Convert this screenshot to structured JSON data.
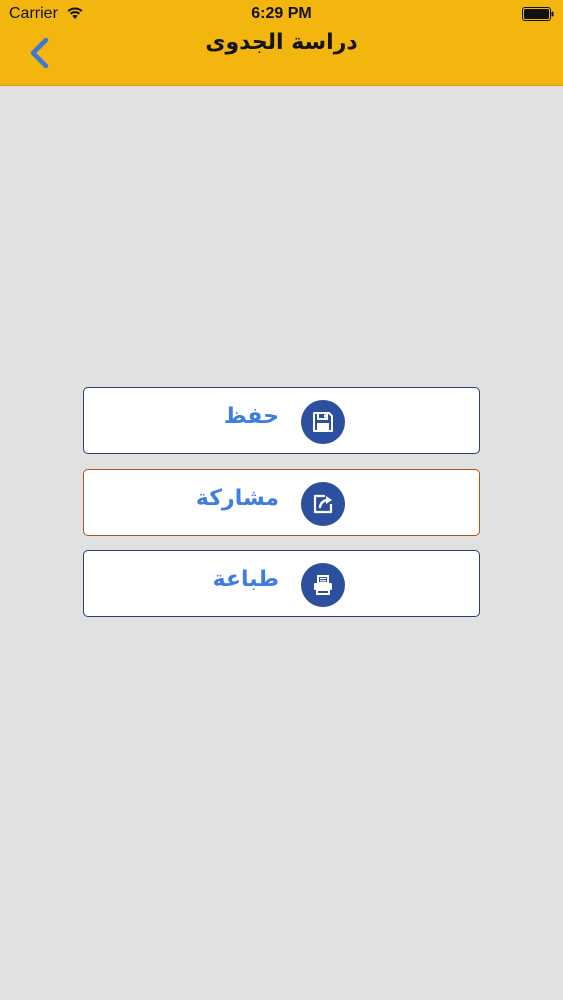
{
  "status_bar": {
    "carrier": "Carrier",
    "time": "6:29 PM"
  },
  "header": {
    "title": "دراسة الجدوى",
    "back_icon": "chevron-left-icon"
  },
  "actions": [
    {
      "label": "حفظ",
      "icon": "floppy-disk-icon"
    },
    {
      "label": "مشاركة",
      "icon": "share-icon"
    },
    {
      "label": "طباعة",
      "icon": "printer-icon"
    }
  ],
  "colors": {
    "header_bg": "#f2b60f",
    "page_bg": "#e2e1e1",
    "button_text": "#3f7de0",
    "icon_bg": "#2d4fa0",
    "back_chevron": "#3a78d8"
  }
}
